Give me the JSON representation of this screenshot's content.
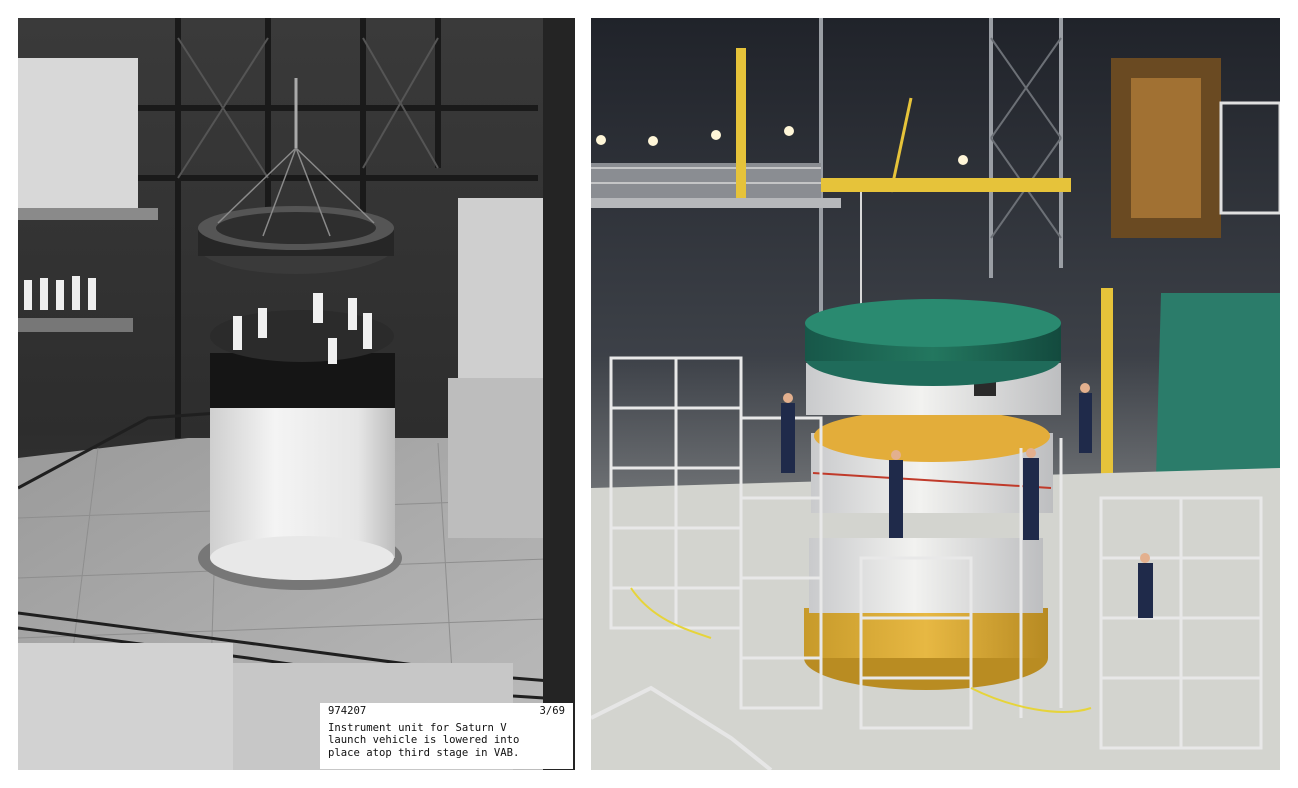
{
  "left_photo": {
    "caption": {
      "id": "974207",
      "date": "3/69",
      "lines": [
        "Instrument unit for Saturn V",
        "launch vehicle is lowered into",
        "place atop third stage in VAB."
      ]
    }
  },
  "colors": {
    "page_background": "#ffffff",
    "caption_background": "#ffffff",
    "right_yellow": "#e6c33a",
    "right_green": "#1f6b5a"
  }
}
